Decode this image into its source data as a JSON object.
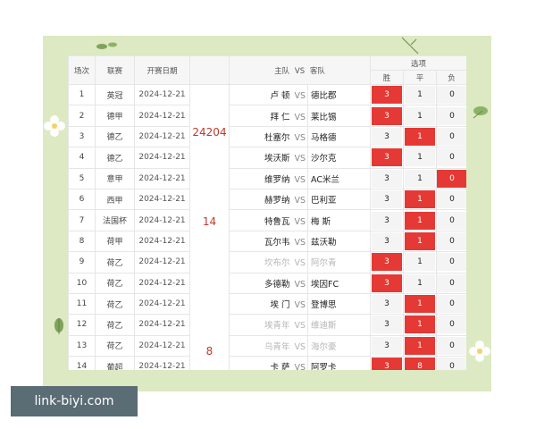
{
  "header": {
    "col_index": "场次",
    "col_league": "联赛",
    "col_date": "开赛日期",
    "col_home": "主队",
    "col_vs": "VS",
    "col_away": "客队",
    "col_options": "选项",
    "opt_win": "胜",
    "opt_draw": "平",
    "opt_loss": "负"
  },
  "side_numbers": {
    "first": "24204",
    "second": "14",
    "third": "8"
  },
  "rows": [
    {
      "idx": "1",
      "league": "英冠",
      "date": "2024-12-21",
      "home": "卢 顿",
      "vs": "VS",
      "away": "德比郡",
      "w": "3",
      "d": "1",
      "l": "0",
      "sel": "w",
      "gray": false
    },
    {
      "idx": "2",
      "league": "德甲",
      "date": "2024-12-21",
      "home": "拜 仁",
      "vs": "VS",
      "away": "莱比锡",
      "w": "3",
      "d": "1",
      "l": "0",
      "sel": "w",
      "gray": false
    },
    {
      "idx": "3",
      "league": "德乙",
      "date": "2024-12-21",
      "home": "杜塞尔",
      "vs": "VS",
      "away": "马格德",
      "w": "3",
      "d": "1",
      "l": "0",
      "sel": "d",
      "gray": false
    },
    {
      "idx": "4",
      "league": "德乙",
      "date": "2024-12-21",
      "home": "埃沃斯",
      "vs": "VS",
      "away": "沙尔克",
      "w": "3",
      "d": "1",
      "l": "0",
      "sel": "w",
      "gray": false
    },
    {
      "idx": "5",
      "league": "意甲",
      "date": "2024-12-21",
      "home": "维罗纳",
      "vs": "VS",
      "away": "AC米兰",
      "w": "3",
      "d": "1",
      "l": "0",
      "sel": "l",
      "gray": false
    },
    {
      "idx": "6",
      "league": "西甲",
      "date": "2024-12-21",
      "home": "赫罗纳",
      "vs": "VS",
      "away": "巴利亚",
      "w": "3",
      "d": "1",
      "l": "0",
      "sel": "d",
      "gray": false
    },
    {
      "idx": "7",
      "league": "法国杯",
      "date": "2024-12-21",
      "home": "特鲁瓦",
      "vs": "VS",
      "away": "梅 斯",
      "w": "3",
      "d": "1",
      "l": "0",
      "sel": "d",
      "gray": false
    },
    {
      "idx": "8",
      "league": "荷甲",
      "date": "2024-12-21",
      "home": "瓦尔韦",
      "vs": "VS",
      "away": "兹沃勒",
      "w": "3",
      "d": "1",
      "l": "0",
      "sel": "d",
      "gray": false
    },
    {
      "idx": "9",
      "league": "荷乙",
      "date": "2024-12-21",
      "home": "坎布尔",
      "vs": "VS",
      "away": "阿尔青",
      "w": "3",
      "d": "1",
      "l": "0",
      "sel": "w",
      "gray": true
    },
    {
      "idx": "10",
      "league": "荷乙",
      "date": "2024-12-21",
      "home": "多德勒",
      "vs": "VS",
      "away": "埃因FC",
      "w": "3",
      "d": "1",
      "l": "0",
      "sel": "w",
      "gray": false
    },
    {
      "idx": "11",
      "league": "荷乙",
      "date": "2024-12-21",
      "home": "埃 门",
      "vs": "VS",
      "away": "登博思",
      "w": "3",
      "d": "1",
      "l": "0",
      "sel": "d",
      "gray": false
    },
    {
      "idx": "12",
      "league": "荷乙",
      "date": "2024-12-21",
      "home": "埃青年",
      "vs": "VS",
      "away": "维迪斯",
      "w": "3",
      "d": "1",
      "l": "0",
      "sel": "d",
      "gray": true
    },
    {
      "idx": "13",
      "league": "荷乙",
      "date": "2024-12-21",
      "home": "乌青年",
      "vs": "VS",
      "away": "海尔豪",
      "w": "3",
      "d": "1",
      "l": "0",
      "sel": "d",
      "gray": true
    },
    {
      "idx": "14",
      "league": "葡超",
      "date": "2024-12-21",
      "home": "卡 萨",
      "vs": "VS",
      "away": "阿罗卡",
      "w": "3",
      "d": "8",
      "l": "0",
      "sel": "wd",
      "gray": false
    }
  ],
  "watermark": "link-biyi.com",
  "colors": {
    "selected": "#e53935",
    "background": "#dce9c2",
    "highlight_number": "#c0392b"
  }
}
